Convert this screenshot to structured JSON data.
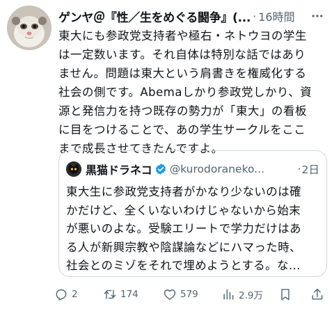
{
  "post": {
    "display_name": "ゲンヤ＠『性／生をめぐる闘争』(...",
    "separator": "·",
    "time": "16時間",
    "text": "東大にも参政党支持者や極右・ネトウヨの学生\nは一定数います。それ自体は特別な話ではあり\nません。問題は東大という肩書きを権威化する\n社会の側です。Abemaしかり参政党しかり、資\n源と発信力を持つ既存の勢力が「東大」の看板\nに目をつけることで、あの学生サークルをここ\nまで成長させてきたんですよ。"
  },
  "quote": {
    "display_name": "黒猫ドラネコ",
    "handle": "@kurodoraneko...",
    "separator": "·",
    "time": "2日",
    "text": "東大生に参政党支持者がかなり少ないのは確\nかだけど、全くいないわけじゃないから始末\nが悪いのよな。受験エリートで学力だけはあ\nる人が新興宗教や陰謀論などにハマった時、\n社会とのミゾをそれで埋めようとする。な..."
  },
  "actions": {
    "replies": "2",
    "reposts": "174",
    "likes": "579",
    "views": "2.9万"
  },
  "colors": {
    "text": "#0f1419",
    "secondary": "#536471",
    "border": "#cfd9de",
    "verified": "#1d9bf0"
  },
  "icons": {
    "more": "more-horizontal-icon",
    "verified": "verified-badge-icon",
    "reply": "reply-icon",
    "repost": "repost-icon",
    "like": "heart-icon",
    "views": "views-chart-icon",
    "bookmark": "bookmark-icon",
    "share": "share-icon"
  }
}
